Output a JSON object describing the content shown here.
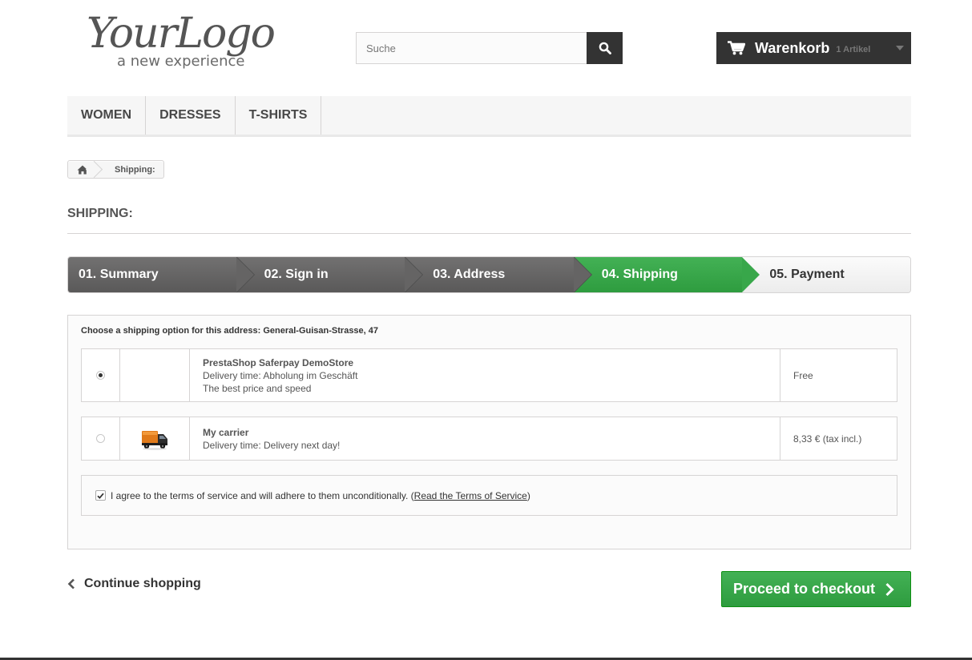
{
  "logo": {
    "main": "YourLogo",
    "tagline": "a new experience"
  },
  "search": {
    "placeholder": "Suche"
  },
  "cart": {
    "label": "Warenkorb",
    "count": "1 Artikel"
  },
  "menu": {
    "items": [
      "WOMEN",
      "DRESSES",
      "T-SHIRTS"
    ]
  },
  "breadcrumb": {
    "current": "Shipping:"
  },
  "page": {
    "heading": "SHIPPING:"
  },
  "steps": [
    "01. Summary",
    "02. Sign in",
    "03. Address",
    "04. Shipping",
    "05. Payment"
  ],
  "delivery": {
    "title": "Choose a shipping option for this address: General-Guisan-Strasse, 47",
    "options": [
      {
        "name": "PrestaShop Saferpay DemoStore",
        "delivery": "Delivery time: Abholung im Geschäft",
        "extra": "The best price and speed",
        "price": "Free",
        "selected": true
      },
      {
        "name": "My carrier",
        "delivery": "Delivery time: Delivery next day!",
        "price": "8,33 € (tax incl.)",
        "selected": false
      }
    ],
    "terms": {
      "text": "I agree to the terms of service and will adhere to them unconditionally.",
      "link": "Read the Terms of Service",
      "checked": true
    }
  },
  "buttons": {
    "continue": "Continue shopping",
    "checkout": "Proceed to checkout"
  },
  "colors": {
    "accent_green": "#38a74a",
    "dark": "#333333"
  }
}
